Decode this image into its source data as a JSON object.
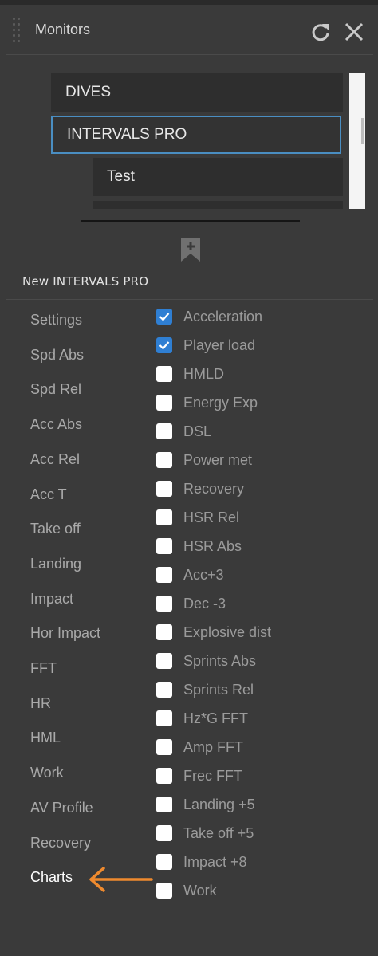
{
  "header": {
    "title": "Monitors"
  },
  "monitor_list": {
    "items": [
      {
        "label": "DIVES",
        "selected": false
      },
      {
        "label": "INTERVALS PRO",
        "selected": true
      },
      {
        "label": "Test",
        "selected": false
      }
    ]
  },
  "new_monitor_label": "New INTERVALS PRO",
  "categories": [
    "Settings",
    "Spd Abs",
    "Spd Rel",
    "Acc Abs",
    "Acc Rel",
    "Acc T",
    "Take off",
    "Landing",
    "Impact",
    "Hor Impact",
    "FFT",
    "HR",
    "HML",
    "Work",
    "AV Profile",
    "Recovery",
    "Charts"
  ],
  "active_category": "Charts",
  "metrics": [
    {
      "label": "Acceleration",
      "checked": true
    },
    {
      "label": "Player load",
      "checked": true
    },
    {
      "label": "HMLD",
      "checked": false
    },
    {
      "label": "Energy Exp",
      "checked": false
    },
    {
      "label": "DSL",
      "checked": false
    },
    {
      "label": "Power met",
      "checked": false
    },
    {
      "label": "Recovery",
      "checked": false
    },
    {
      "label": "HSR Rel",
      "checked": false
    },
    {
      "label": "HSR Abs",
      "checked": false
    },
    {
      "label": "Acc+3",
      "checked": false
    },
    {
      "label": "Dec -3",
      "checked": false
    },
    {
      "label": "Explosive dist",
      "checked": false
    },
    {
      "label": "Sprints Abs",
      "checked": false
    },
    {
      "label": "Sprints Rel",
      "checked": false
    },
    {
      "label": "Hz*G FFT",
      "checked": false
    },
    {
      "label": "Amp FFT",
      "checked": false
    },
    {
      "label": "Frec FFT",
      "checked": false
    },
    {
      "label": "Landing +5",
      "checked": false
    },
    {
      "label": "Take off +5",
      "checked": false
    },
    {
      "label": "Impact +8",
      "checked": false
    },
    {
      "label": "Work",
      "checked": false
    }
  ],
  "colors": {
    "panel_bg": "#3a3a3a",
    "selection_border": "#4a8ec2",
    "checkbox_checked": "#2f7fd3",
    "annotation_arrow": "#ef8a2e"
  }
}
